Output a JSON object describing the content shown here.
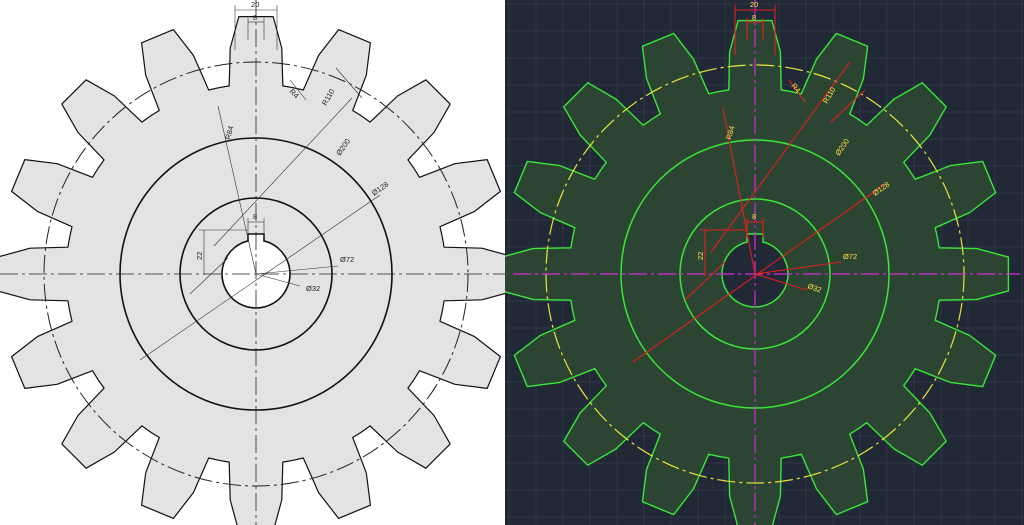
{
  "dimensions": {
    "tooth_width": "20",
    "keyway_width_top": "8",
    "root_radius": "R4",
    "outer_radius": "R110",
    "pitch_radius": "R84",
    "pitch_diameter": "Ø200",
    "hub_diameter": "Ø128",
    "boss_diameter": "Ø72",
    "bore_diameter": "Ø32",
    "keyway_width": "8",
    "keyway_depth": "22"
  },
  "gear": {
    "teeth": 16
  },
  "colors": {
    "left_background": "#ffffff",
    "left_fill": "#e3e3e3",
    "left_line": "#111111",
    "left_center_line": "#222222",
    "right_background": "#212836",
    "right_grid": "#2f3747",
    "right_line": "#39e639",
    "right_fill": "#2e4a33",
    "right_pitch_circle": "#e6e63a",
    "right_center_line": "#d62ad6",
    "right_dimension_line": "#e02020",
    "right_dimension_text": "#ffe14a"
  }
}
